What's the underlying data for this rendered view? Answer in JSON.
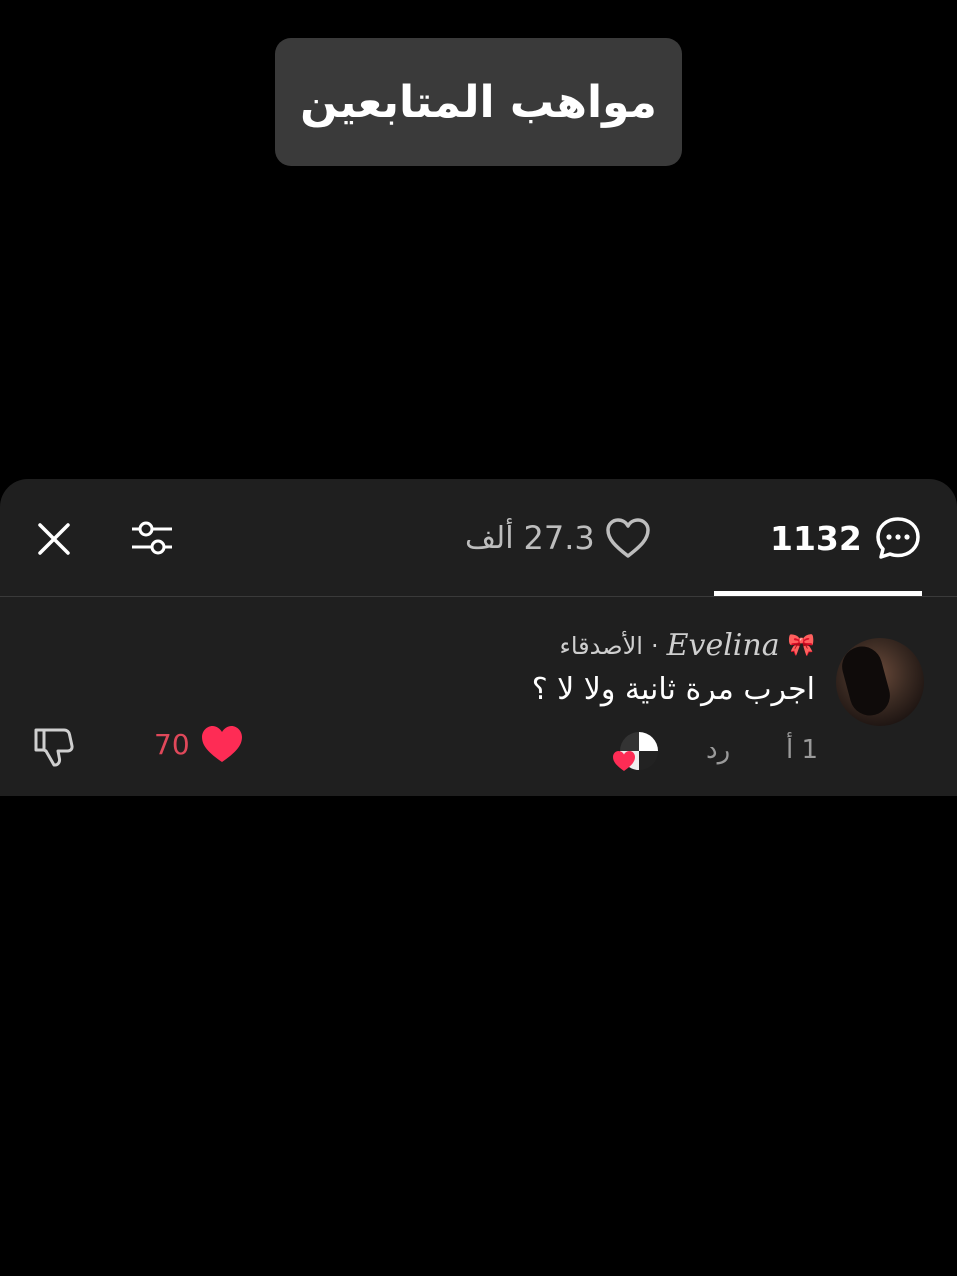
{
  "banner": {
    "title": "مواهب المتابعين"
  },
  "header": {
    "likes_count": "27.3",
    "likes_unit": "ألف",
    "comments_count": "1132"
  },
  "comment": {
    "username": "Evelina",
    "badge": "🎀",
    "separator": "·",
    "relation": "الأصدقاء",
    "text": "اجرب مرة ثانية ولا لا ؟",
    "time": "1 أ",
    "reply_label": "رد",
    "like_count": "70"
  },
  "colors": {
    "background": "#000000",
    "sheet": "#1f1f1f",
    "like_red": "#fe2c55",
    "muted_text": "#9a9a9a"
  },
  "icons": [
    "close-icon",
    "filter-icon",
    "heart-outline-icon",
    "comment-bubble-icon",
    "heart-filled-icon",
    "thumbs-down-icon"
  ]
}
